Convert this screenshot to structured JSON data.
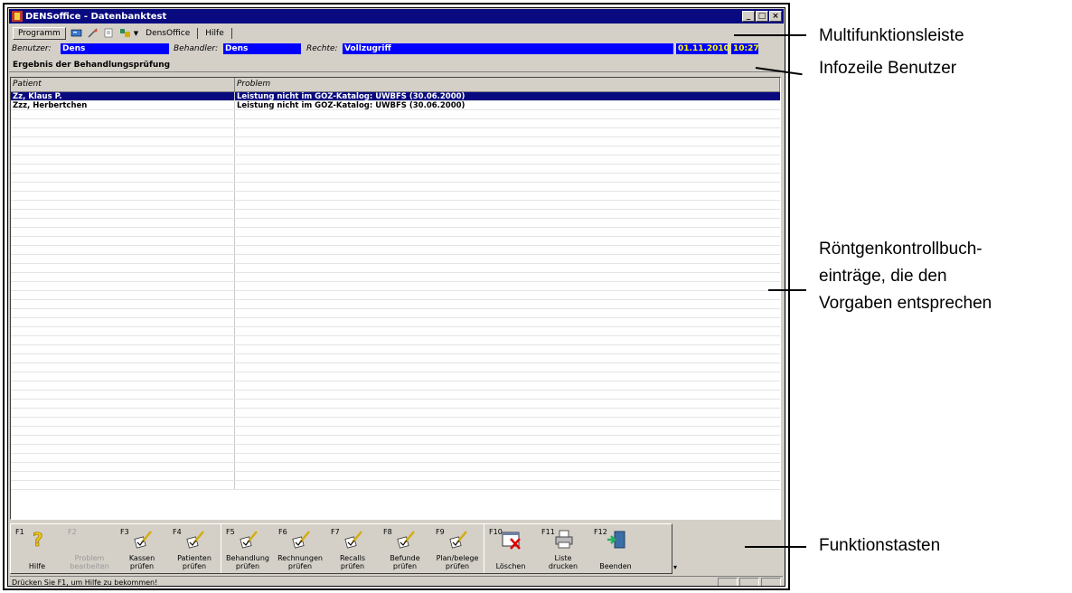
{
  "window": {
    "title": "DENSoffice - Datenbanktest",
    "buttons": [
      "_",
      "□",
      "×"
    ]
  },
  "menubar": {
    "program": "Programm",
    "densoffice": "DensOffice",
    "help": "Hilfe",
    "icons": [
      "card-icon",
      "pen-icon",
      "notes-icon",
      "palette-icon",
      "dropdown-arrow-icon"
    ]
  },
  "infobar": {
    "user_label": "Benutzer:",
    "user_value": "Dens",
    "practitioner_label": "Behandler:",
    "practitioner_value": "Dens",
    "rights_label": "Rechte:",
    "rights_value": "Vollzugriff",
    "date": "01.11.2010",
    "time": "10:27"
  },
  "section_title": "Ergebnis der Behandlungsprüfung",
  "table": {
    "columns": [
      "Patient",
      "Problem"
    ],
    "rows": [
      {
        "patient": "Zz, Klaus P.",
        "problem": "Leistung nicht im GOZ-Katalog: UWBFS (30.06.2000)",
        "selected": true
      },
      {
        "patient": "Zzz, Herbertchen",
        "problem": "Leistung nicht im GOZ-Katalog: UWBFS (30.06.2000)",
        "selected": false
      }
    ],
    "empty_rows": 42
  },
  "function_keys": [
    {
      "key": "F1",
      "label1": "",
      "label2": "Hilfe",
      "icon": "question-icon",
      "enabled": true
    },
    {
      "key": "F2",
      "label1": "Problem",
      "label2": "bearbeiten",
      "icon": "",
      "enabled": false
    },
    {
      "key": "F3",
      "label1": "Kassen",
      "label2": "prüfen",
      "icon": "check-pen-icon",
      "enabled": true
    },
    {
      "key": "F4",
      "label1": "Patienten",
      "label2": "prüfen",
      "icon": "check-pen-icon",
      "enabled": true
    },
    {
      "key": "F5",
      "label1": "Behandlung",
      "label2": "prüfen",
      "icon": "check-pen-icon",
      "enabled": true
    },
    {
      "key": "F6",
      "label1": "Rechnungen",
      "label2": "prüfen",
      "icon": "check-pen-icon",
      "enabled": true
    },
    {
      "key": "F7",
      "label1": "Recalls",
      "label2": "prüfen",
      "icon": "check-pen-icon",
      "enabled": true
    },
    {
      "key": "F8",
      "label1": "Befunde",
      "label2": "prüfen",
      "icon": "check-pen-icon",
      "enabled": true
    },
    {
      "key": "F9",
      "label1": "Plan/belege",
      "label2": "prüfen",
      "icon": "check-pen-icon",
      "enabled": true
    },
    {
      "key": "F10",
      "label1": "",
      "label2": "Löschen",
      "icon": "delete-icon",
      "enabled": true
    },
    {
      "key": "F11",
      "label1": "Liste",
      "label2": "drucken",
      "icon": "printer-icon",
      "enabled": true
    },
    {
      "key": "F12",
      "label1": "",
      "label2": "Beenden",
      "icon": "exit-door-icon",
      "enabled": true
    }
  ],
  "statusbar": {
    "text": "Drücken Sie F1, um Hilfe zu bekommen!"
  },
  "annotations": {
    "multifunction": "Multifunktionsleiste",
    "infoline": "Infozeile Benutzer",
    "xray1": "Röntgenkontrollbuch-",
    "xray2": "einträge, die den",
    "xray3": "Vorgaben entsprechen",
    "fkeys": "Funktionstasten"
  }
}
